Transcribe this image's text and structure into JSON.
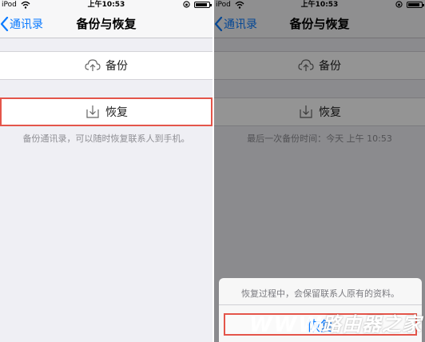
{
  "left": {
    "status": {
      "carrier": "iPod",
      "time": "上午10:53"
    },
    "nav": {
      "back_label": "通讯录",
      "title": "备份与恢复"
    },
    "backup_label": "备份",
    "restore_label": "恢复",
    "footnote": "备份通讯录，可以随时恢复联系人到手机。"
  },
  "right": {
    "status": {
      "carrier": "iPod",
      "time": "上午10:53"
    },
    "nav": {
      "back_label": "通讯录",
      "title": "备份与恢复"
    },
    "backup_label": "备份",
    "restore_label": "恢复",
    "footnote": "最后一次备份时间：今天 上午 10:53",
    "sheet": {
      "message": "恢复过程中，会保留联系人原有的资料。",
      "confirm_label": "恢复"
    }
  },
  "watermark": {
    "text": "路由器之家",
    "latin": "WWW"
  },
  "colors": {
    "accent": "#0a7aff",
    "highlight": "#e4554a",
    "background": "#efeff4"
  }
}
